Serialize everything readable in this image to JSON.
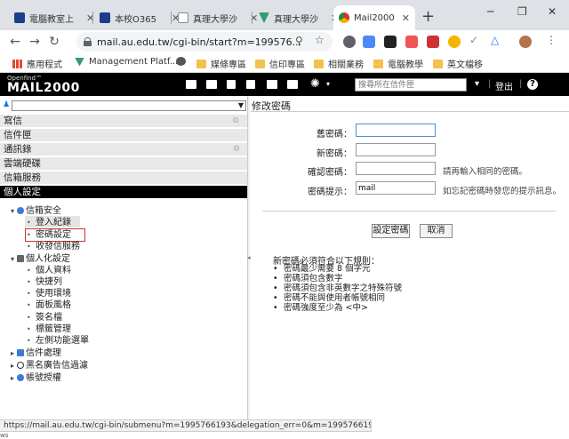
{
  "colors": {
    "tabstrip": "#dee1e6",
    "header": "#000000",
    "highlight_border": "#d0302a",
    "active_menu": "#000000"
  },
  "browser": {
    "tabs": [
      {
        "title": "電腦教室上",
        "icon": "mail-icon",
        "color": "#1a3e8c"
      },
      {
        "title": "本校O365",
        "icon": "mail-icon",
        "color": "#1a3e8c"
      },
      {
        "title": "真理大學沙",
        "icon": "document-icon",
        "color": "#888888"
      },
      {
        "title": "真理大學沙",
        "icon": "vuetify-icon",
        "color": "#2e9e6f"
      },
      {
        "title": "Mail2000",
        "icon": "chrome-icon",
        "color": "#d93025"
      }
    ],
    "url": "mail.au.edu.tw/cgi-bin/start?m=199576...",
    "bookmarks": [
      {
        "label": "應用程式",
        "icon": "apps-icon"
      },
      {
        "label": "Management Platf...",
        "icon": "vuetify-icon"
      },
      {
        "label": "",
        "icon": "globe-icon"
      },
      {
        "label": "媒條專區",
        "icon": "folder-icon"
      },
      {
        "label": "信印專區",
        "icon": "folder-icon"
      },
      {
        "label": "相關業務",
        "icon": "folder-icon"
      },
      {
        "label": "電腦教學",
        "icon": "folder-icon"
      },
      {
        "label": "英文檔移",
        "icon": "folder-icon"
      }
    ]
  },
  "app": {
    "logo_small": "Openfind™",
    "logo": "MAIL2000",
    "search_placeholder": "搜尋所在信件匣",
    "logout": "登出",
    "help": "?",
    "user_select": "▼"
  },
  "left": {
    "menu": [
      {
        "label": "寫信"
      },
      {
        "label": "信件匣"
      },
      {
        "label": "通訊錄"
      },
      {
        "label": "雲端硬碟"
      },
      {
        "label": "信箱服務"
      },
      {
        "label": "個人設定"
      }
    ],
    "tree": [
      {
        "label": "信箱安全",
        "level": 0
      },
      {
        "label": "登入紀錄",
        "level": 1
      },
      {
        "label": "密碼設定",
        "level": 1
      },
      {
        "label": "收發信服務",
        "level": 1
      },
      {
        "label": "個人化設定",
        "level": 0
      },
      {
        "label": "個人資料",
        "level": 1
      },
      {
        "label": "快捷列",
        "level": 1
      },
      {
        "label": "使用環境",
        "level": 1
      },
      {
        "label": "面板風格",
        "level": 1
      },
      {
        "label": "簽名檔",
        "level": 1
      },
      {
        "label": "標籤管理",
        "level": 1
      },
      {
        "label": "左側功能選單",
        "level": 1
      },
      {
        "label": "信件處理",
        "level": 0
      },
      {
        "label": "黑名廣告信過濾",
        "level": 0
      },
      {
        "label": "帳號授權",
        "level": 0
      }
    ]
  },
  "right": {
    "title": "修改密碼",
    "fields": [
      {
        "label": "舊密碼：",
        "value": "",
        "hint": ""
      },
      {
        "label": "新密碼：",
        "value": "",
        "hint": ""
      },
      {
        "label": "確認密碼：",
        "value": "",
        "hint": "請再輸入相同的密碼。"
      },
      {
        "label": "密碼提示：",
        "value": "mail",
        "hint": "如忘記密碼時發您的提示訊息。"
      }
    ],
    "confirm_button": "設定密碼",
    "cancel_button": "取消",
    "rules_title": "新密碼必須符合以下規則：",
    "rules": [
      "密碼最少需要 8 個字元",
      "密碼須包含數字",
      "密碼須包含非英數字之特殊符號",
      "密碼不能與使用者帳號相同",
      "密碼強度至少為 <中>"
    ]
  },
  "status_url": "https://mail.au.edu.tw/cgi-bin/submenu?m=1995766193&delegation_err=0&m=1995766193#",
  "status_below": "ws"
}
